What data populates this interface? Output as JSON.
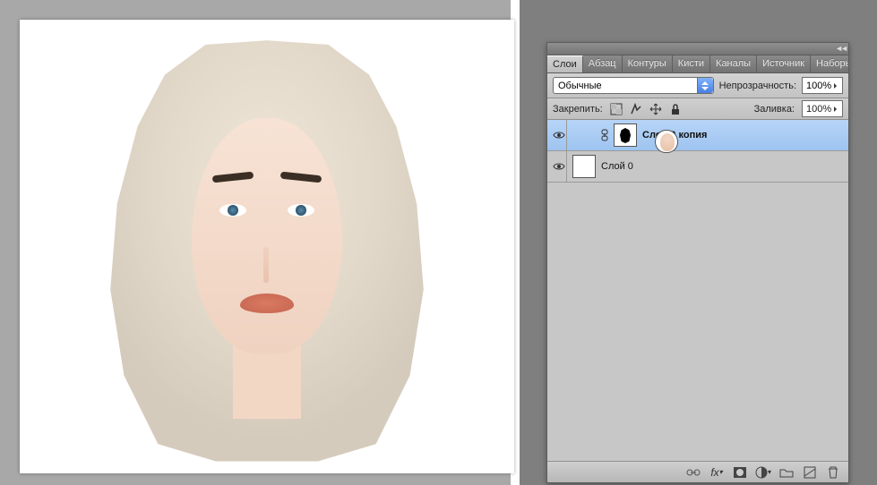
{
  "panel": {
    "tabs": [
      {
        "label": "Слои",
        "active": true
      },
      {
        "label": "Абзац",
        "active": false
      },
      {
        "label": "Контуры",
        "active": false
      },
      {
        "label": "Кисти",
        "active": false
      },
      {
        "label": "Каналы",
        "active": false
      },
      {
        "label": "Источник",
        "active": false
      },
      {
        "label": "Наборы ки",
        "active": false
      }
    ],
    "blend_mode": "Обычные",
    "opacity_label": "Непрозрачность:",
    "opacity_value": "100%",
    "lock_label": "Закрепить:",
    "fill_label": "Заливка:",
    "fill_value": "100%",
    "layers": [
      {
        "name": "Слой 0 копия",
        "selected": true,
        "has_mask": true,
        "visible": true,
        "thumb": "face"
      },
      {
        "name": "Слой 0",
        "selected": false,
        "has_mask": false,
        "visible": true,
        "thumb": "white"
      }
    ],
    "footer_icons": [
      "link",
      "fx",
      "mask",
      "adjust",
      "group",
      "new",
      "trash"
    ]
  }
}
